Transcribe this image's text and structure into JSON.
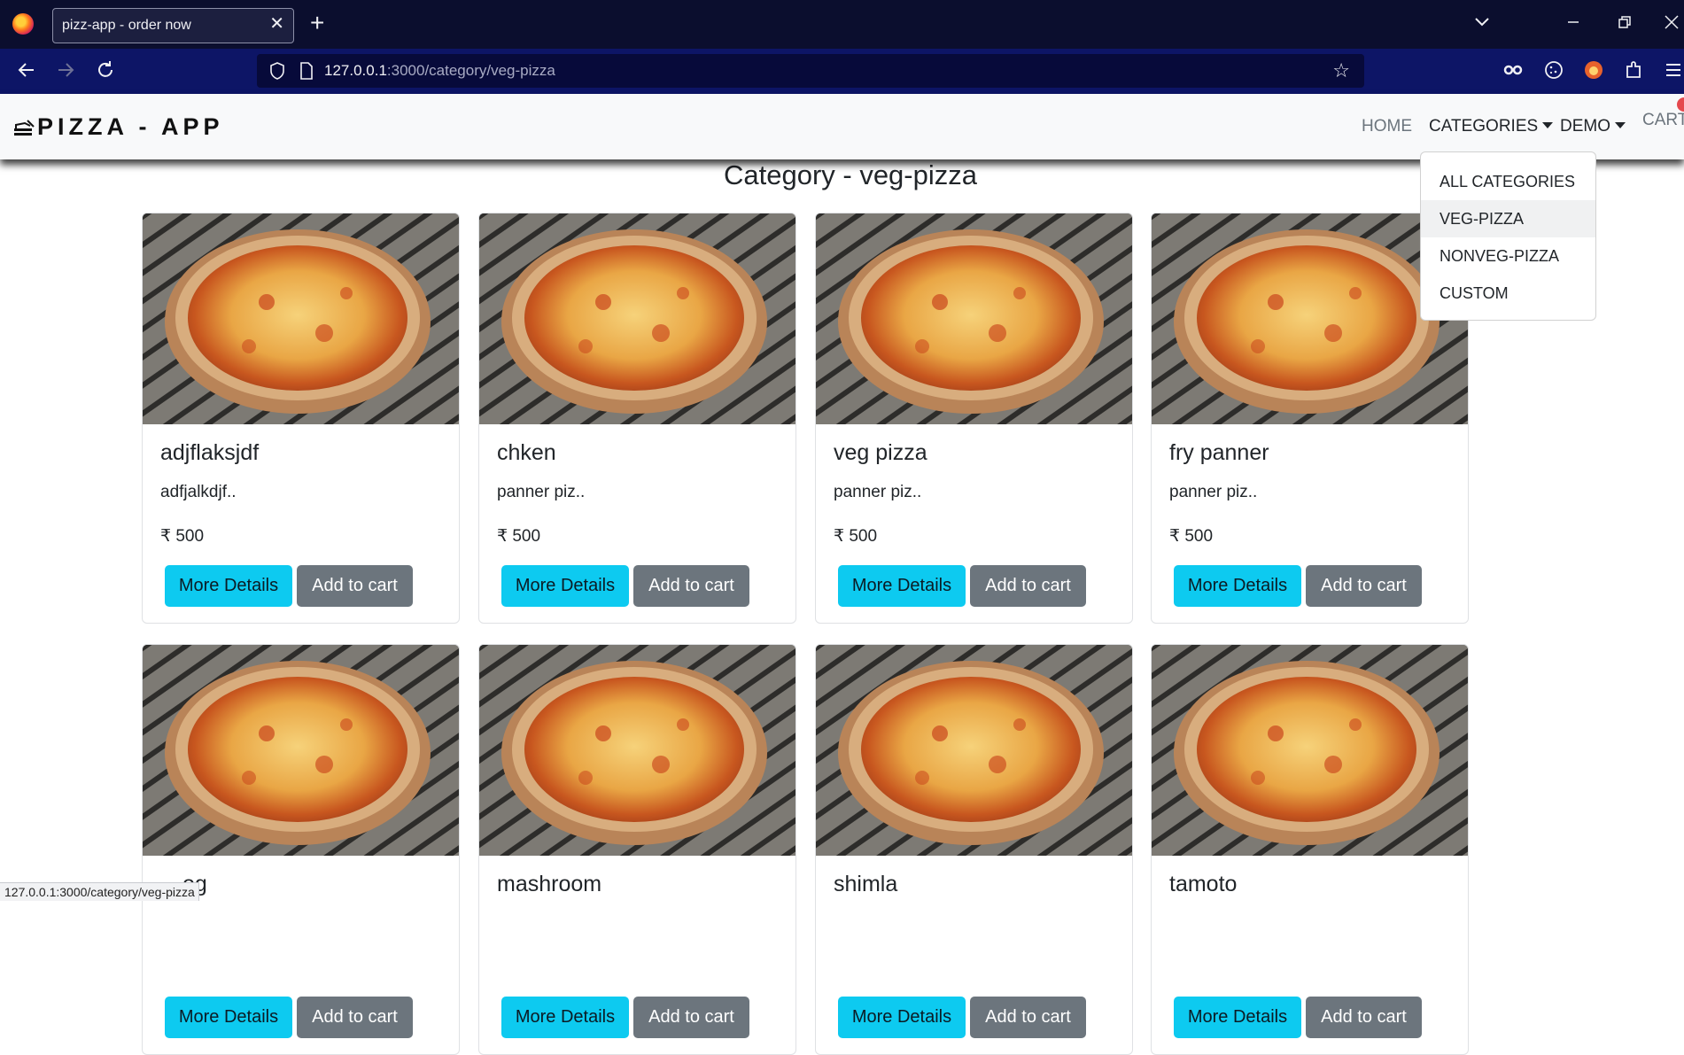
{
  "browser": {
    "tab_title": "pizz-app - order now",
    "tab_close": "✕",
    "new_tab": "+",
    "url_host": "127.0.0.1",
    "url_path": ":3000/category/veg-pizza",
    "status_url": "127.0.0.1:3000/category/veg-pizza"
  },
  "nav": {
    "brand": "PIZZA - APP",
    "links": {
      "home": "HOME",
      "categories": "CATEGORIES",
      "demo": "DEMO",
      "cart": "CART"
    },
    "dropdown": [
      "ALL CATEGORIES",
      "VEG-PIZZA",
      "NONVEG-PIZZA",
      "CUSTOM"
    ],
    "dropdown_active": "VEG-PIZZA"
  },
  "page": {
    "heading": "Category - veg-pizza",
    "more_label": "More Details",
    "cart_label": "Add to cart"
  },
  "products": [
    {
      "name": "adjflaksjdf",
      "desc": "adfjalkdjf..",
      "price": "₹ 500"
    },
    {
      "name": "chken",
      "desc": "panner piz..",
      "price": "₹ 500"
    },
    {
      "name": "veg pizza",
      "desc": "panner piz..",
      "price": "₹ 500"
    },
    {
      "name": "fry panner",
      "desc": "panner piz..",
      "price": "₹ 500"
    },
    {
      "name": "…og",
      "desc": "",
      "price": ""
    },
    {
      "name": "mashroom",
      "desc": "",
      "price": ""
    },
    {
      "name": "shimla",
      "desc": "",
      "price": ""
    },
    {
      "name": "tamoto",
      "desc": "",
      "price": ""
    }
  ],
  "colors": {
    "btn_more": "#0dcaf0",
    "btn_cart": "#6c757d",
    "tabbar": "#0b0e2e",
    "toolbar": "#0d1566"
  }
}
